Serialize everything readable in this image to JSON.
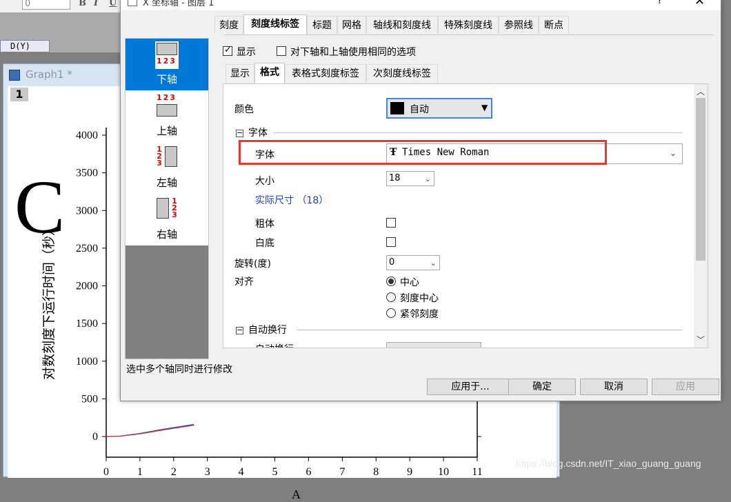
{
  "background": {
    "font_size_value": "0",
    "format_buttons": [
      "B",
      "I",
      "U"
    ],
    "sheet_column": "D(Y)",
    "graph_title": "Graph1 *",
    "layer_number": "1",
    "big_letter": "C",
    "y_axis_title": "对数刻度下运行时间（秒）",
    "x_axis_title": "A",
    "watermark": "https://blog.csdn.net/IT_xiao_guang_guang"
  },
  "chart_data": {
    "type": "line",
    "x_ticks": [
      "0",
      "1",
      "2",
      "3",
      "4",
      "5",
      "6",
      "7",
      "8",
      "9",
      "10",
      "11"
    ],
    "y_ticks": [
      "0",
      "500",
      "1000",
      "1500",
      "2000",
      "2500",
      "3000",
      "3500",
      "4000"
    ],
    "xlim": [
      0,
      11
    ],
    "ylim": [
      0,
      4000
    ],
    "ylabel": "对数刻度下运行时间（秒）",
    "xlabel": "A",
    "series": [
      {
        "color": "#1f3fb5",
        "x": [
          0,
          0.4,
          1,
          1.6,
          2.6
        ],
        "y": [
          0,
          5,
          40,
          90,
          160
        ]
      },
      {
        "color": "#c0392b",
        "x": [
          0,
          0.4,
          1,
          1.6,
          2.6
        ],
        "y": [
          0,
          3,
          35,
          80,
          150
        ]
      }
    ]
  },
  "dialog": {
    "title": "X 坐标轴 - 图层 1",
    "help": "?",
    "close": "✕",
    "tabs": [
      "刻度",
      "刻度线标签",
      "标题",
      "网格",
      "轴线和刻度线",
      "特殊刻度线",
      "参照线",
      "断点"
    ],
    "active_tab": "刻度线标签",
    "axes": [
      {
        "label": "下轴",
        "nums": "123"
      },
      {
        "label": "上轴",
        "nums": "123"
      },
      {
        "label": "左轴",
        "nums": "123"
      },
      {
        "label": "右轴",
        "nums": "123"
      }
    ],
    "status": "选中多个轴同时进行修改",
    "show_label": "显示",
    "same_options_label": "对下轴和上轴使用相同的选项",
    "sub_tabs": [
      "显示",
      "格式",
      "表格式刻度标签",
      "次刻度线标签"
    ],
    "active_sub_tab": "格式",
    "props": {
      "color_label": "颜色",
      "color_value": "自动",
      "font_section": "字体",
      "font_label": "字体",
      "font_value": "Times New Roman",
      "size_label": "大小",
      "size_value": "18",
      "actual_size": "实际尺寸 （18）",
      "bold_label": "粗体",
      "white_bg_label": "白底",
      "rotation_label": "旋转(度)",
      "rotation_value": "0",
      "align_label": "对齐",
      "align_options": [
        "中心",
        "刻度中心",
        "紧邻刻度"
      ],
      "wrap_section": "自动换行",
      "wrap_label": "自动换行"
    },
    "buttons": {
      "apply_to": "应用于...",
      "ok": "确定",
      "cancel": "取消",
      "apply": "应用"
    }
  }
}
